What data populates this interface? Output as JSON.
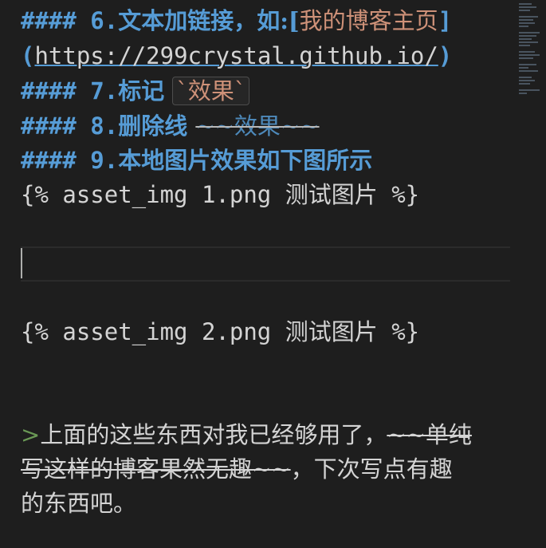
{
  "editor": {
    "line6": {
      "prefix": "#### 6.",
      "text": "文本加链接，如:[",
      "link_text": "我的博客主页",
      "close": "]"
    },
    "line6b": {
      "open": "(",
      "url": "https://299crystal.github.io/",
      "close": ")"
    },
    "line7": {
      "prefix": "#### 7.",
      "text": "标记 ",
      "code": "`效果`"
    },
    "line8": {
      "prefix": "#### 8.",
      "text": "删除线 ",
      "strike": "~~效果~~"
    },
    "line9": {
      "prefix": "#### 9.",
      "text": "本地图片效果如下图所示"
    },
    "asset1": "{% asset_img 1.png 测试图片 %}",
    "asset2": "{% asset_img 2.png 测试图片 %}",
    "quote": {
      "marker": ">",
      "text_a": "上面的这些东西对我已经够用了，",
      "strike_a": "~~单纯",
      "strike_b": "写这样的博客果然无趣~~",
      "text_b": "，下次写点有趣",
      "text_c": "的东西吧。"
    }
  }
}
